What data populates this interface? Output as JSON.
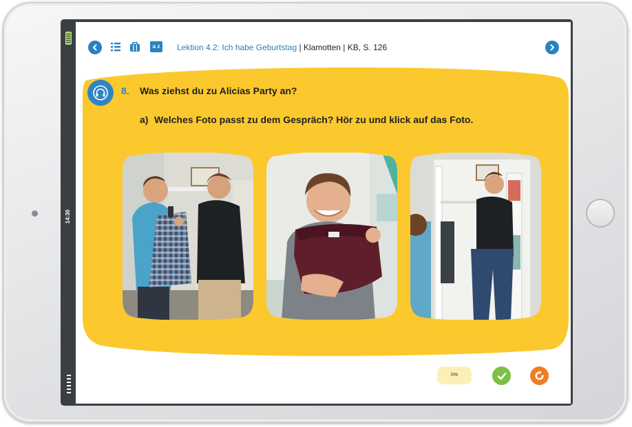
{
  "device": {
    "clock": "14:30"
  },
  "toolbar": {
    "icons": [
      "chevron-left-icon",
      "list-icon",
      "bag-icon",
      "dictionary-icon",
      "chevron-right-icon"
    ],
    "breadcrumb_lesson": "Lektion 4.2: Ich habe Geburtstag",
    "breadcrumb_separator": " | ",
    "breadcrumb_topic": "Klamotten",
    "breadcrumb_page": "KB, S. 126",
    "dictionary_label": "a z"
  },
  "task": {
    "icon": "headphones-icon",
    "number": "8.",
    "title": "Was ziehst du zu Alicias Party an?",
    "sub_letter": "a)",
    "instruction": "Welches Foto passt zu dem Gespräch? Hör zu und klick auf das Foto."
  },
  "photos": [
    {
      "description": "two-boys-with-checked-shirt"
    },
    {
      "description": "boy-holding-burgundy-sweater"
    },
    {
      "description": "boy-trying-on-jeans-at-wardrobe"
    }
  ],
  "footer": {
    "progress": "0%",
    "check_icon": "check-icon",
    "reset_icon": "reset-icon"
  },
  "colors": {
    "accent_blue": "#2a82c0",
    "panel_yellow": "#fbc92d",
    "check_green": "#7bc143",
    "reset_orange": "#ef7d22"
  }
}
